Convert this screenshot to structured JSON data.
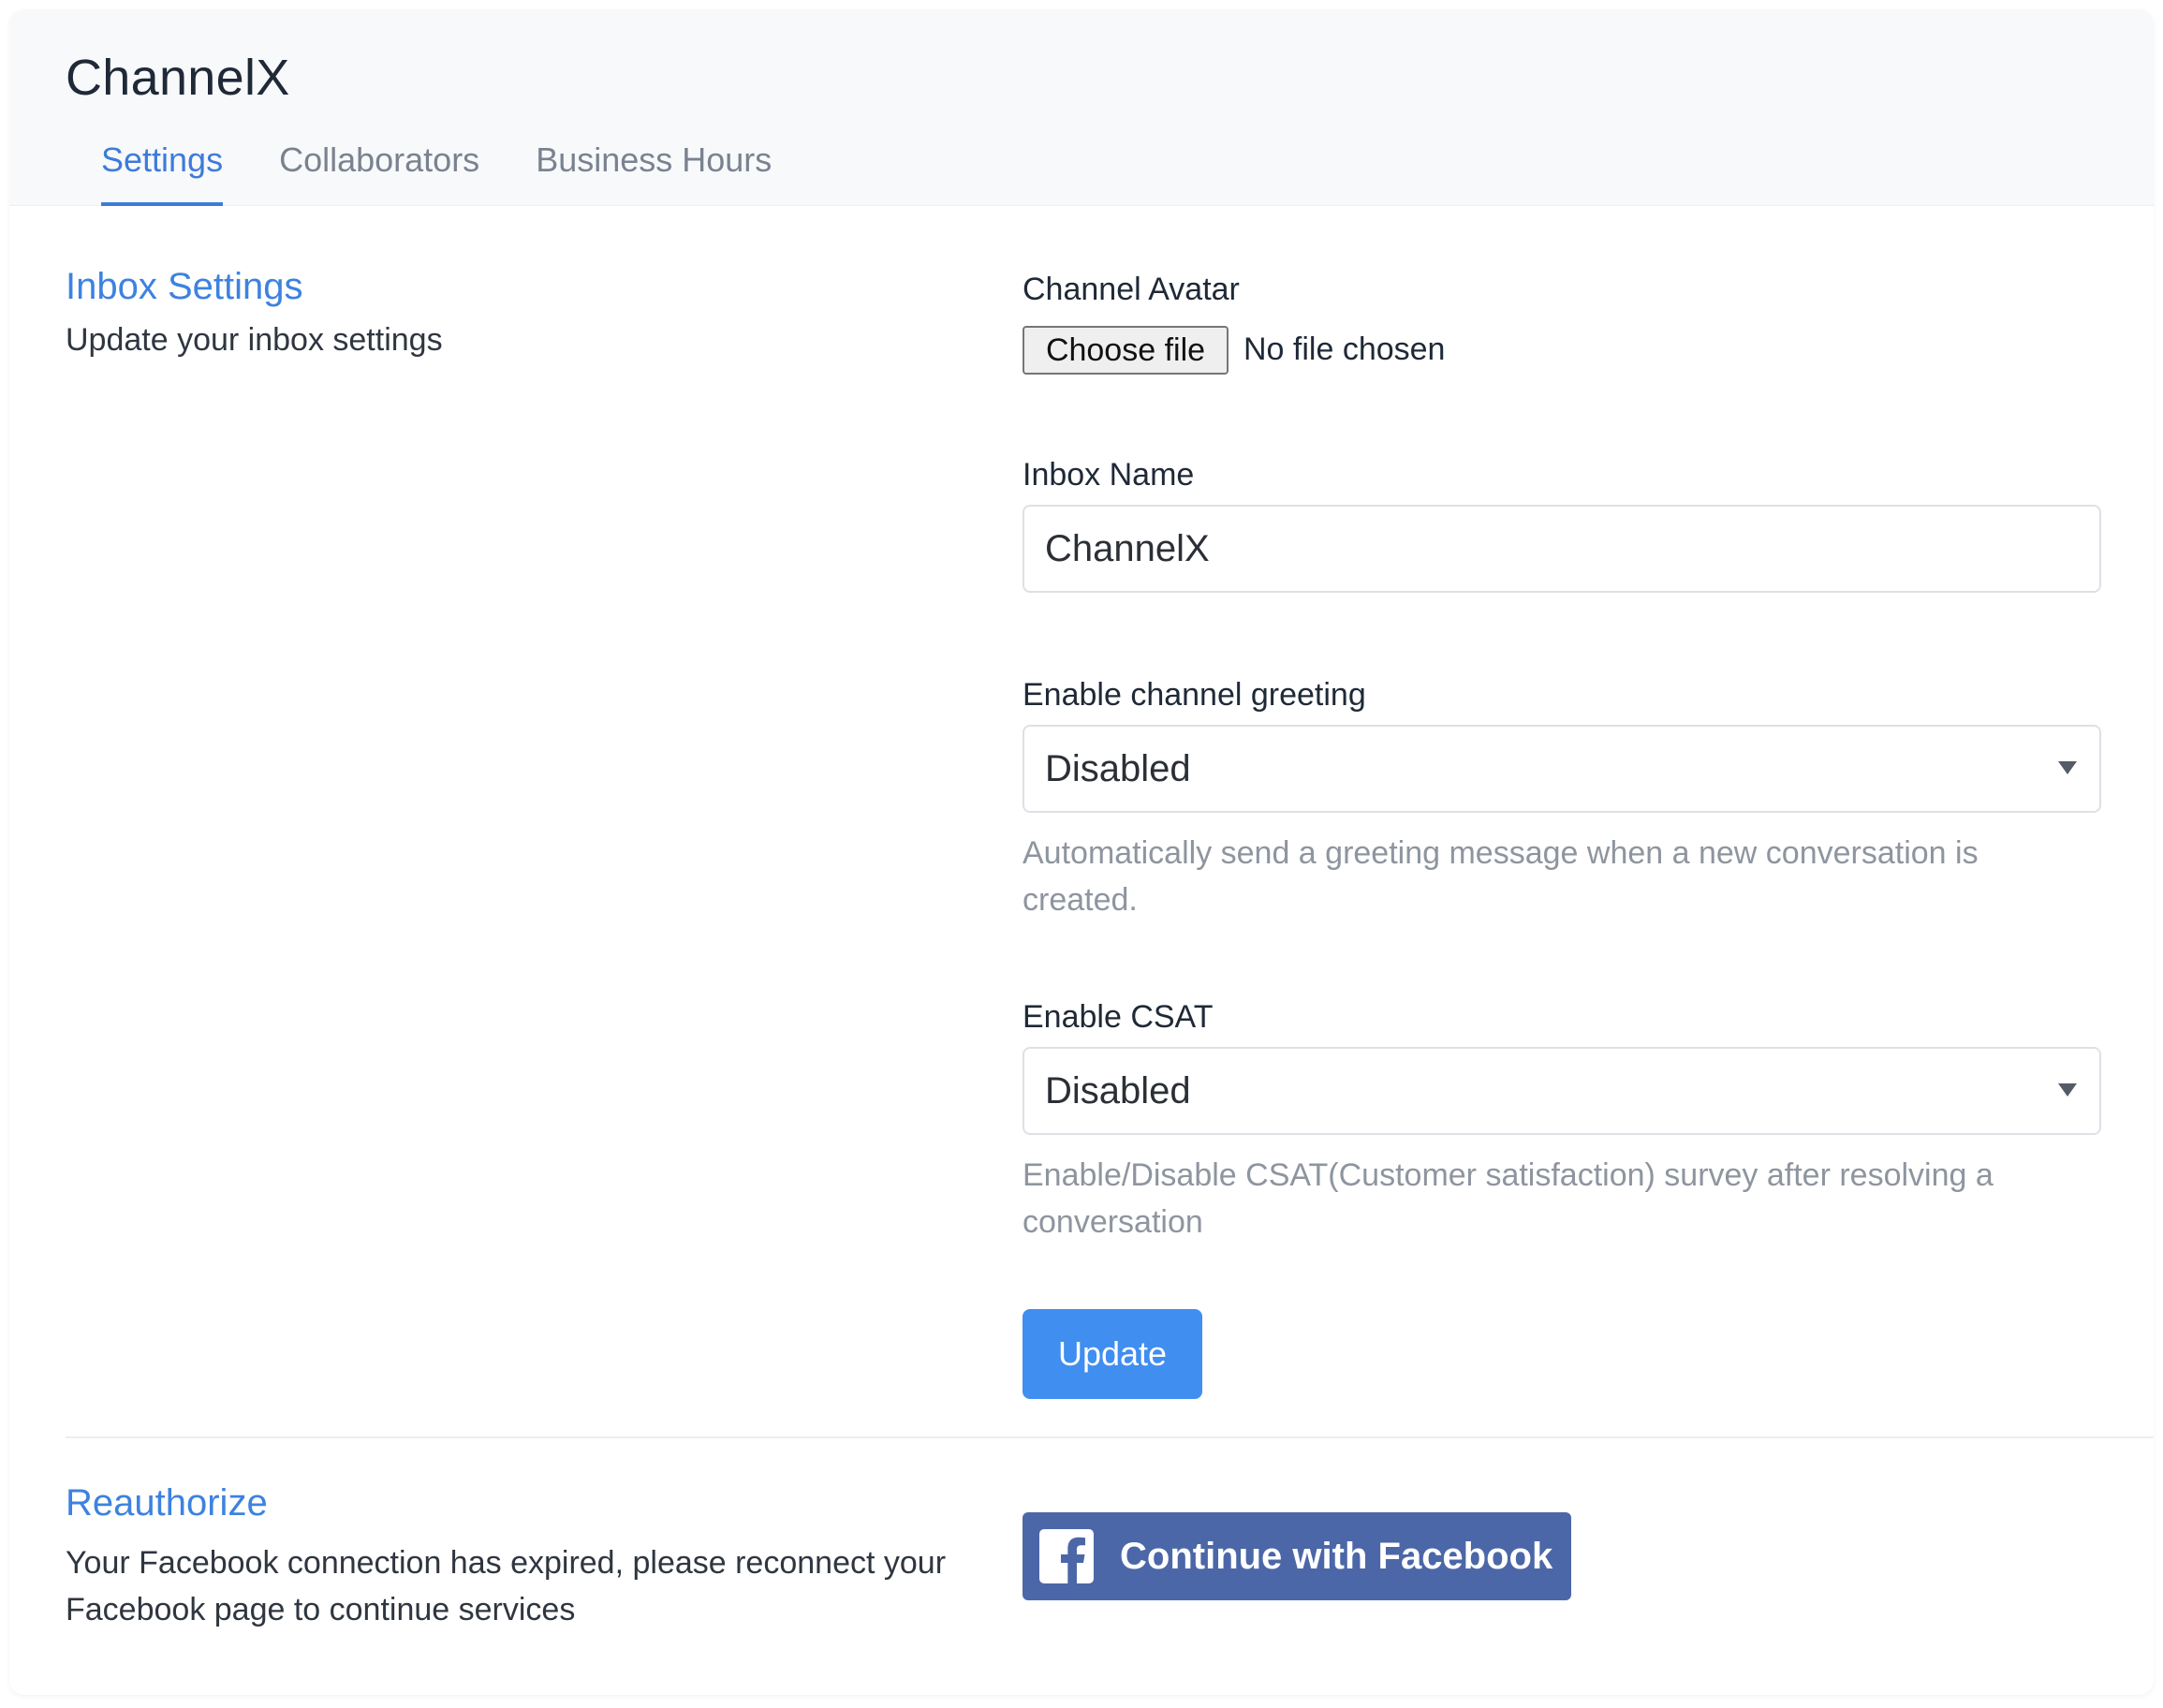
{
  "app": {
    "title": "ChannelX"
  },
  "tabs": [
    {
      "label": "Settings",
      "active": true
    },
    {
      "label": "Collaborators",
      "active": false
    },
    {
      "label": "Business Hours",
      "active": false
    }
  ],
  "inbox_settings": {
    "title": "Inbox Settings",
    "description": "Update your inbox settings"
  },
  "form": {
    "avatar": {
      "label": "Channel Avatar",
      "button_label": "Choose file",
      "status": "No file chosen"
    },
    "inbox_name": {
      "label": "Inbox Name",
      "value": "ChannelX"
    },
    "greeting": {
      "label": "Enable channel greeting",
      "selected": "Disabled",
      "help": "Automatically send a greeting message when a new conversation is created."
    },
    "csat": {
      "label": "Enable CSAT",
      "selected": "Disabled",
      "help": "Enable/Disable CSAT(Customer satisfaction) survey after resolving a conversation"
    },
    "update_button": "Update"
  },
  "reauthorize": {
    "title": "Reauthorize",
    "description": "Your Facebook connection has expired, please reconnect your Facebook page to continue services",
    "button_label": "Continue with Facebook",
    "button_icon": "facebook-icon"
  },
  "colors": {
    "accent": "#3d82e0",
    "update_button": "#3f8ef0",
    "facebook": "#4c67a8",
    "help_text": "#8e959f"
  }
}
